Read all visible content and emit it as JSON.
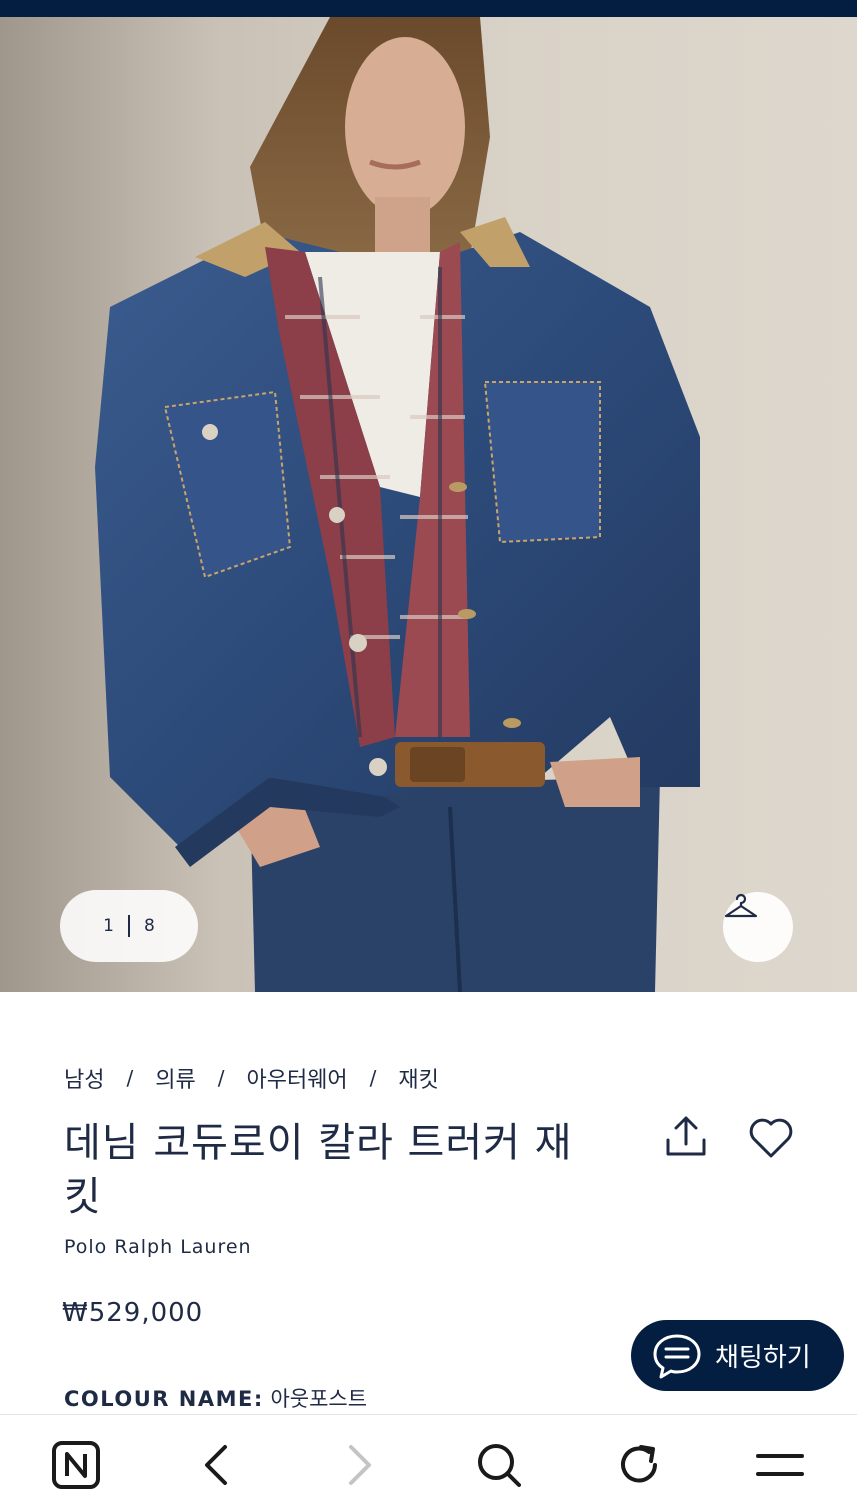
{
  "gallery": {
    "current": "1",
    "total": "8",
    "hanger_icon": "hanger-icon"
  },
  "breadcrumb": {
    "items": [
      "남성",
      "의류",
      "아우터웨어",
      "재킷"
    ],
    "separator": "/"
  },
  "product": {
    "title": "데님 코듀로이 칼라 트러커 재킷",
    "brand": "Polo Ralph Lauren",
    "price": "₩529,000",
    "colour_label": "COLOUR NAME:",
    "colour_value": "아웃포스트"
  },
  "chat": {
    "label": "채팅하기",
    "icon": "chat-bubble-icon"
  },
  "toolbar": {
    "icons": [
      "naver-n-icon",
      "back-arrow-icon",
      "forward-arrow-icon",
      "search-icon",
      "refresh-icon",
      "menu-icon"
    ]
  },
  "colors": {
    "navy": "#041e42",
    "text": "#1f2a44",
    "denim": "#2d4a78"
  }
}
